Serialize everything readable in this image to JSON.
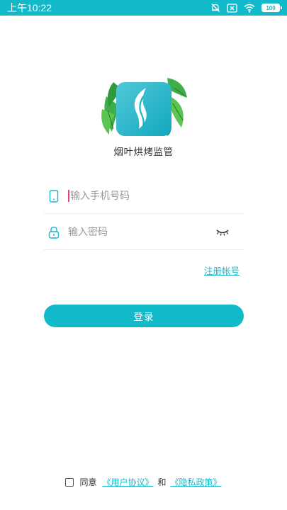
{
  "status_bar": {
    "time": "上午10:22",
    "battery": "100",
    "icons": [
      "alarm-off-icon",
      "sim-missing-icon",
      "wifi-icon",
      "battery-icon"
    ]
  },
  "app": {
    "name": "烟叶烘烤监管",
    "logo_icon": "tobacco-leaf-logo"
  },
  "form": {
    "phone_placeholder": "输入手机号码",
    "password_placeholder": "输入密码",
    "phone_value": "",
    "password_value": "",
    "register_label": "注册帐号",
    "login_label": "登录"
  },
  "agreement": {
    "checked": false,
    "agree_label": "同意",
    "user_agreement": "《用户协议》",
    "and_label": "和",
    "privacy_policy": "《隐私政策》"
  },
  "colors": {
    "accent": "#12b9c9",
    "caret": "#e0467a",
    "leaf_green": "#3fae49"
  }
}
